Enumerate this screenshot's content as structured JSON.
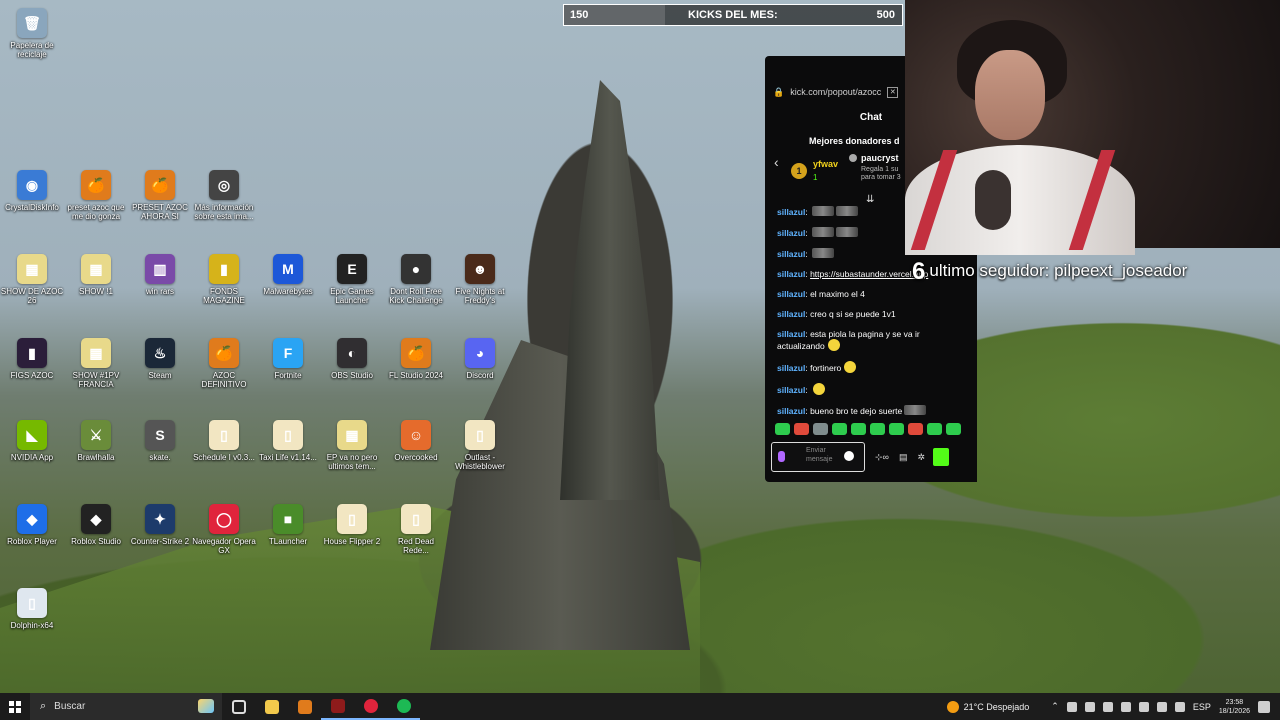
{
  "desktop": {
    "icons": [
      {
        "label": "Papelera de reciclaje",
        "glyph": "🗑",
        "color": "#8aa6bd"
      },
      {
        "label": "CrystalDiskInfo",
        "glyph": "◉",
        "color": "#3a7bd5"
      },
      {
        "label": "preset azoc que me dio gonza",
        "glyph": "🍊",
        "color": "#e07b1c"
      },
      {
        "label": "PRESET AZOC AHORA SI",
        "glyph": "🍊",
        "color": "#e07b1c"
      },
      {
        "label": "Más información sobre esta ima...",
        "glyph": "◎",
        "color": "#444"
      },
      {
        "label": "SHOW DE AZOC 26",
        "glyph": "▦",
        "color": "#e8d98a"
      },
      {
        "label": "SHOW !1",
        "glyph": "▦",
        "color": "#e8d98a"
      },
      {
        "label": "win rars",
        "glyph": "▥",
        "color": "#7a4aa8"
      },
      {
        "label": "FONDS MAGAZINE",
        "glyph": "▮",
        "color": "#d6b31a"
      },
      {
        "label": "Malwarebytes",
        "glyph": "M",
        "color": "#1d58d8"
      },
      {
        "label": "Epic Games Launcher",
        "glyph": "E",
        "color": "#222"
      },
      {
        "label": "Dont Roll Free Kick Challenge",
        "glyph": "●",
        "color": "#333"
      },
      {
        "label": "Five Nights at Freddy's",
        "glyph": "☻",
        "color": "#4a2a1a"
      },
      {
        "label": "FIGS AZOC",
        "glyph": "▮",
        "color": "#2b1e3a"
      },
      {
        "label": "SHOW #1PV FRANCIA",
        "glyph": "▦",
        "color": "#e8d98a"
      },
      {
        "label": "Steam",
        "glyph": "♨",
        "color": "#1b2838"
      },
      {
        "label": "AZOC DEFINITIVO",
        "glyph": "🍊",
        "color": "#e07b1c"
      },
      {
        "label": "Fortnite",
        "glyph": "F",
        "color": "#2aa4f4"
      },
      {
        "label": "OBS Studio",
        "glyph": "◐",
        "color": "#302e31"
      },
      {
        "label": "FL Studio 2024",
        "glyph": "🍊",
        "color": "#e07b1c"
      },
      {
        "label": "Discord",
        "glyph": "◕",
        "color": "#5865f2"
      },
      {
        "label": "NVIDIA App",
        "glyph": "◣",
        "color": "#76b900"
      },
      {
        "label": "Brawlhalla",
        "glyph": "⚔",
        "color": "#6a8c3a"
      },
      {
        "label": "skate.",
        "glyph": "S",
        "color": "#555"
      },
      {
        "label": "Schedule I v0.3...",
        "glyph": "▯",
        "color": "#f2e6c2"
      },
      {
        "label": "Taxi Life v1.14...",
        "glyph": "▯",
        "color": "#f2e6c2"
      },
      {
        "label": "EP va no pero ultimos tem...",
        "glyph": "▦",
        "color": "#e8d98a"
      },
      {
        "label": "Overcooked",
        "glyph": "☺",
        "color": "#e56b2c"
      },
      {
        "label": "Outlast - Whistleblower",
        "glyph": "▯",
        "color": "#f2e6c2"
      },
      {
        "label": "Roblox Player",
        "glyph": "◆",
        "color": "#1e6ee8"
      },
      {
        "label": "Roblox Studio",
        "glyph": "◆",
        "color": "#222"
      },
      {
        "label": "Counter-Strike 2",
        "glyph": "✦",
        "color": "#1d3b6b"
      },
      {
        "label": "Navegador Opera GX",
        "glyph": "◯",
        "color": "#e0243c"
      },
      {
        "label": "TLauncher",
        "glyph": "■",
        "color": "#4a8c2a"
      },
      {
        "label": "House Flipper 2",
        "glyph": "▯",
        "color": "#f2e6c2"
      },
      {
        "label": "Red Dead Rede...",
        "glyph": "▯",
        "color": "#f2e6c2"
      },
      {
        "label": "Dolphin-x64",
        "glyph": "▯",
        "color": "#dfe7ef"
      }
    ]
  },
  "kicks_bar": {
    "current": "150",
    "title": "KICKS DEL MES:",
    "goal": "500",
    "progress_fraction": 0.3
  },
  "chat": {
    "url": "kick.com/popout/azocc",
    "title": "Chat",
    "donors_title": "Mejores donadores d",
    "top_donor_rank": "1",
    "top_donor_name": "yfwav",
    "top_donor_amount": "1",
    "second_donor_name": "paucryst",
    "second_donor_note": "Regala 1 su para tomar 3",
    "messages": [
      {
        "user": "sillazul",
        "text": "",
        "emotes": 2
      },
      {
        "user": "sillazul",
        "text": "",
        "emotes": 2
      },
      {
        "user": "sillazul",
        "text": "",
        "emotes": 1
      },
      {
        "user": "sillazul",
        "text": "https://subastaunder.vercel.app",
        "link": true
      },
      {
        "user": "sillazul",
        "text": "el maximo el 4"
      },
      {
        "user": "sillazul",
        "text": "creo q si se puede 1v1"
      },
      {
        "user": "sillazul",
        "text": "esta piola la pagina y se va ir actualizando",
        "emoji": true
      },
      {
        "user": "sillazul",
        "text": "fortinero",
        "emoji": true
      },
      {
        "user": "sillazul",
        "text": "",
        "emoji": true
      },
      {
        "user": "sillazul",
        "text": "bueno bro te dejo suerte",
        "emotes": 1
      }
    ],
    "input_placeholder": "Enviar mensaje",
    "send_label": "Ch"
  },
  "overlay": {
    "follower_count": "6",
    "follower_text": "ultimo seguidor: pilpeext_joseador"
  },
  "taskbar": {
    "search_placeholder": "Buscar",
    "weather": "21°C Despejado",
    "language": "ESP",
    "time": "23:58",
    "date": "18/1/2026",
    "colors": {
      "file_explorer": "#f2c94c",
      "fl_studio": "#e07b1c",
      "obs": "#8e1b1b",
      "opera": "#e0243c",
      "spotify": "#1db954"
    }
  }
}
